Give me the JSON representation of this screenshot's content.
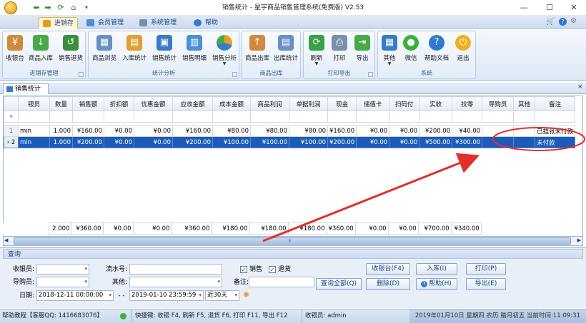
{
  "window": {
    "title": "销售统计 - 星宇商品销售管理系统(免费版) V2.53"
  },
  "menu_tabs": [
    "进销存",
    "会员管理",
    "系统管理",
    "帮助"
  ],
  "ribbon_groups": [
    {
      "label": "进销存管理",
      "buttons": [
        "收银台",
        "商品入库",
        "销售退货"
      ]
    },
    {
      "label": "统计分析",
      "buttons": [
        "商品浏览",
        "入库统计",
        "销售统计",
        "销售明细",
        "销售分析"
      ]
    },
    {
      "label": "商品出库",
      "buttons": [
        "商品出库",
        "出库统计"
      ]
    },
    {
      "label": "打印导出",
      "buttons": [
        "刷新",
        "打印",
        "导出"
      ]
    },
    {
      "label": "系统",
      "buttons": [
        "其他",
        "微信",
        "帮助文档",
        "退出"
      ]
    }
  ],
  "doc_tab": "销售统计",
  "grid": {
    "columns": [
      "银员",
      "数量",
      "销售额",
      "折扣额",
      "优惠金额",
      "应收金额",
      "成本金额",
      "商品利润",
      "单据利润",
      "现金",
      "储值卡",
      "扫码付",
      "实收",
      "找零",
      "导购员",
      "其他",
      "备注"
    ],
    "rows": [
      {
        "index": "1",
        "cells": [
          "min",
          "1.000",
          "¥160.00",
          "¥0.00",
          "¥0.00",
          "¥160.00",
          "¥80.00",
          "¥80.00",
          "¥80.00",
          "¥160.00",
          "¥0.00",
          "¥0.00",
          "¥200.00",
          "¥40.00",
          "",
          "",
          "已挂张未付款"
        ]
      },
      {
        "index": "2",
        "cells": [
          "min",
          "1.000",
          "¥200.00",
          "¥0.00",
          "¥0.00",
          "¥200.00",
          "¥100.00",
          "¥100.00",
          "¥100.00",
          "¥200.00",
          "¥0.00",
          "¥0.00",
          "¥500.00",
          "¥300.00",
          "",
          "",
          "未付款"
        ]
      }
    ],
    "totals": [
      "",
      "2.000",
      "¥360.00",
      "¥0.00",
      "¥0.00",
      "¥360.00",
      "¥180.00",
      "¥180.00",
      "¥180.00",
      "¥360.00",
      "¥0.00",
      "¥0.00",
      "¥700.00",
      "¥340.00",
      "",
      "",
      ""
    ]
  },
  "query": {
    "title": "查询",
    "cashier_label": "收银员:",
    "serial_label": "流水号:",
    "guide_label": "导购员:",
    "other_label": "其他:",
    "remark_label": "备注:",
    "date_label": "日期:",
    "date_from": "2018-12-11 00:00:00",
    "date_sep": "- -",
    "date_to": "2019-01-10 23:59:59",
    "range": "近30天",
    "chk_sale": "销售",
    "chk_return": "退货",
    "btn_cashier": "收银台(F4)",
    "btn_in": "入库(I)",
    "btn_print": "打印(P)",
    "btn_query_all": "查询全部(Q)",
    "btn_delete": "删除(D)",
    "btn_help": "帮助(H)",
    "btn_export": "导出(E)"
  },
  "status": {
    "help": "帮助教程【客服QQ: 1416683076】",
    "shortcuts": "快捷键: 收银 F4, 刷新 F5, 退货 F6, 打印 F11, 导出 F12",
    "cashier": "收银员: admin",
    "datetime": "2019年01月10日 星期四 农历 腊月初五 当前时间:11:09:31"
  },
  "colors": {
    "selection": "#1c5cb8",
    "annotation": "#e0302a",
    "ribbon": "#dde8f5"
  }
}
